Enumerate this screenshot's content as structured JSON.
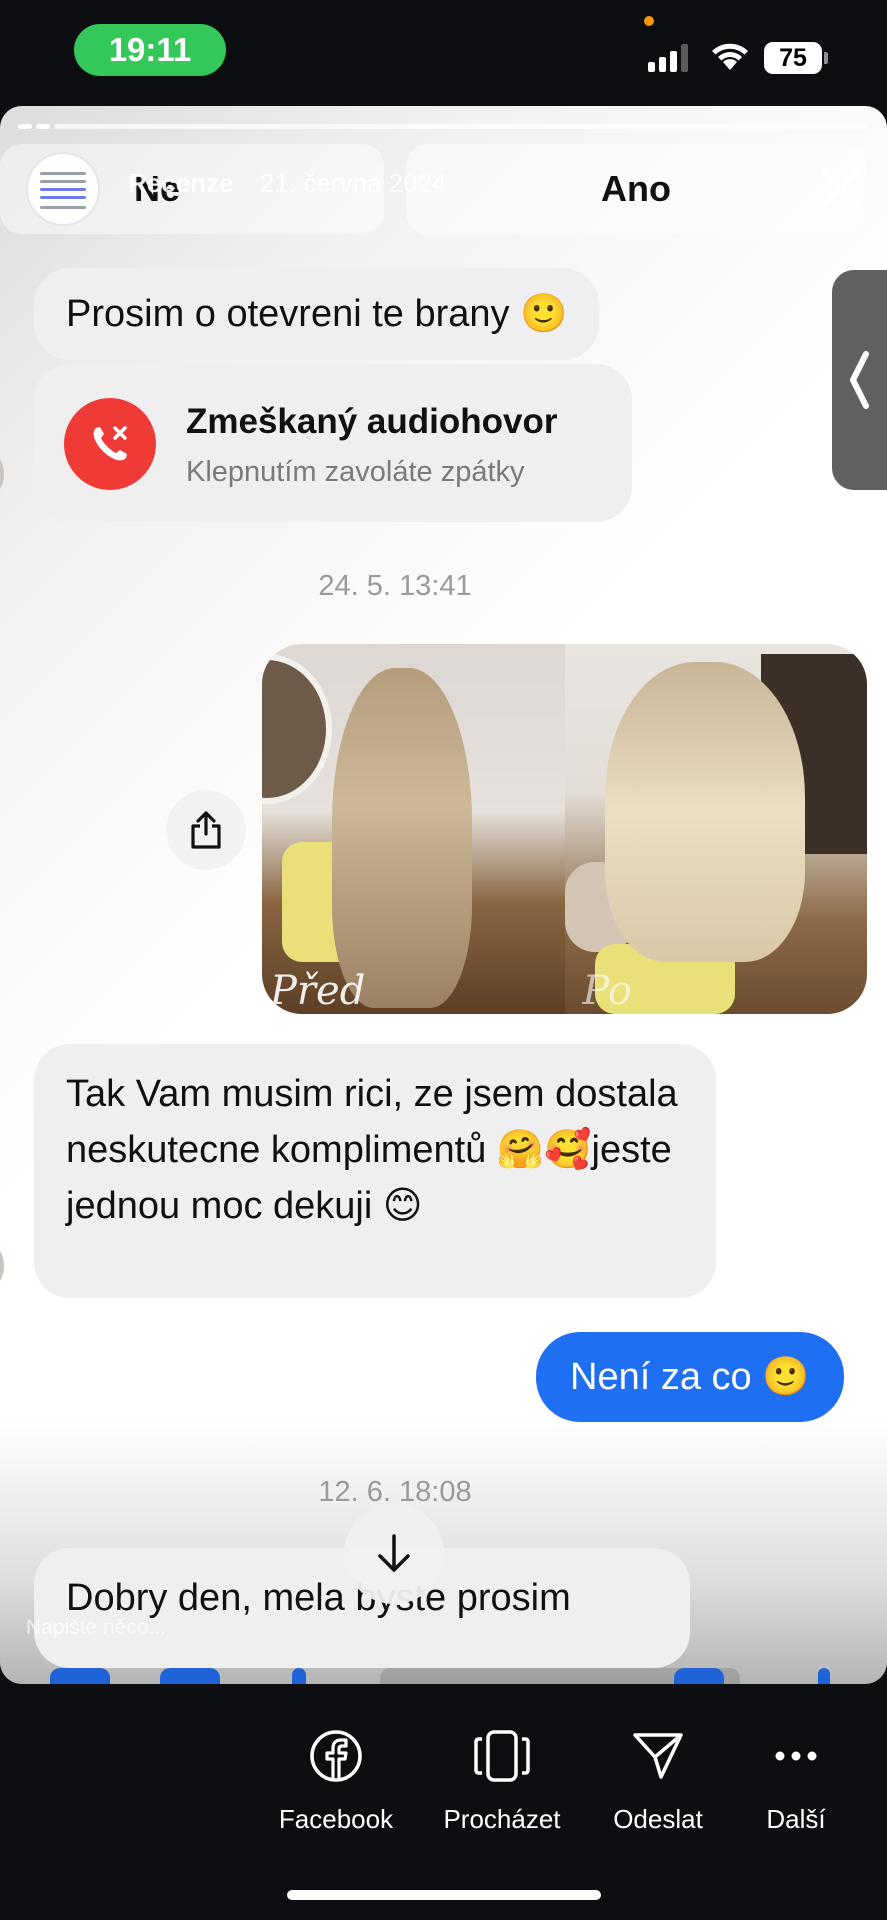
{
  "status_bar": {
    "time": "19:11",
    "battery": "75"
  },
  "story": {
    "header_name": "Recenze",
    "header_date": "21. června 2024",
    "poll": {
      "option_no": "Ne",
      "option_yes": "Ano"
    }
  },
  "chat": {
    "msg1": "Prosim o otevreni te brany 🙂",
    "missed_call": {
      "title": "Zmeškaný audiohovor",
      "subtitle": "Klepnutím zavoláte zpátky"
    },
    "timestamp1": "24. 5. 13:41",
    "photo_labels": {
      "before": "Před",
      "after": "Po"
    },
    "msg2": "Tak Vam musim rici, ze jsem dostala neskutecne komplimentů 🤗🥰jeste jednou moc dekuji 😊",
    "msg3": "Není za co 🙂",
    "timestamp2": "12. 6. 18:08",
    "msg4": "Dobry den, mela byste prosim",
    "compose_placeholder": "Napište něco..."
  },
  "share_sheet": {
    "items": [
      {
        "label": "Facebook",
        "icon": "facebook-icon"
      },
      {
        "label": "Procházet",
        "icon": "browse-icon"
      },
      {
        "label": "Odeslat",
        "icon": "send-icon"
      },
      {
        "label": "Další",
        "icon": "more-icon"
      }
    ]
  },
  "colors": {
    "accent_blue": "#1f6ff2",
    "missed_call_red": "#ef3a36",
    "time_pill_green": "#34c759"
  }
}
